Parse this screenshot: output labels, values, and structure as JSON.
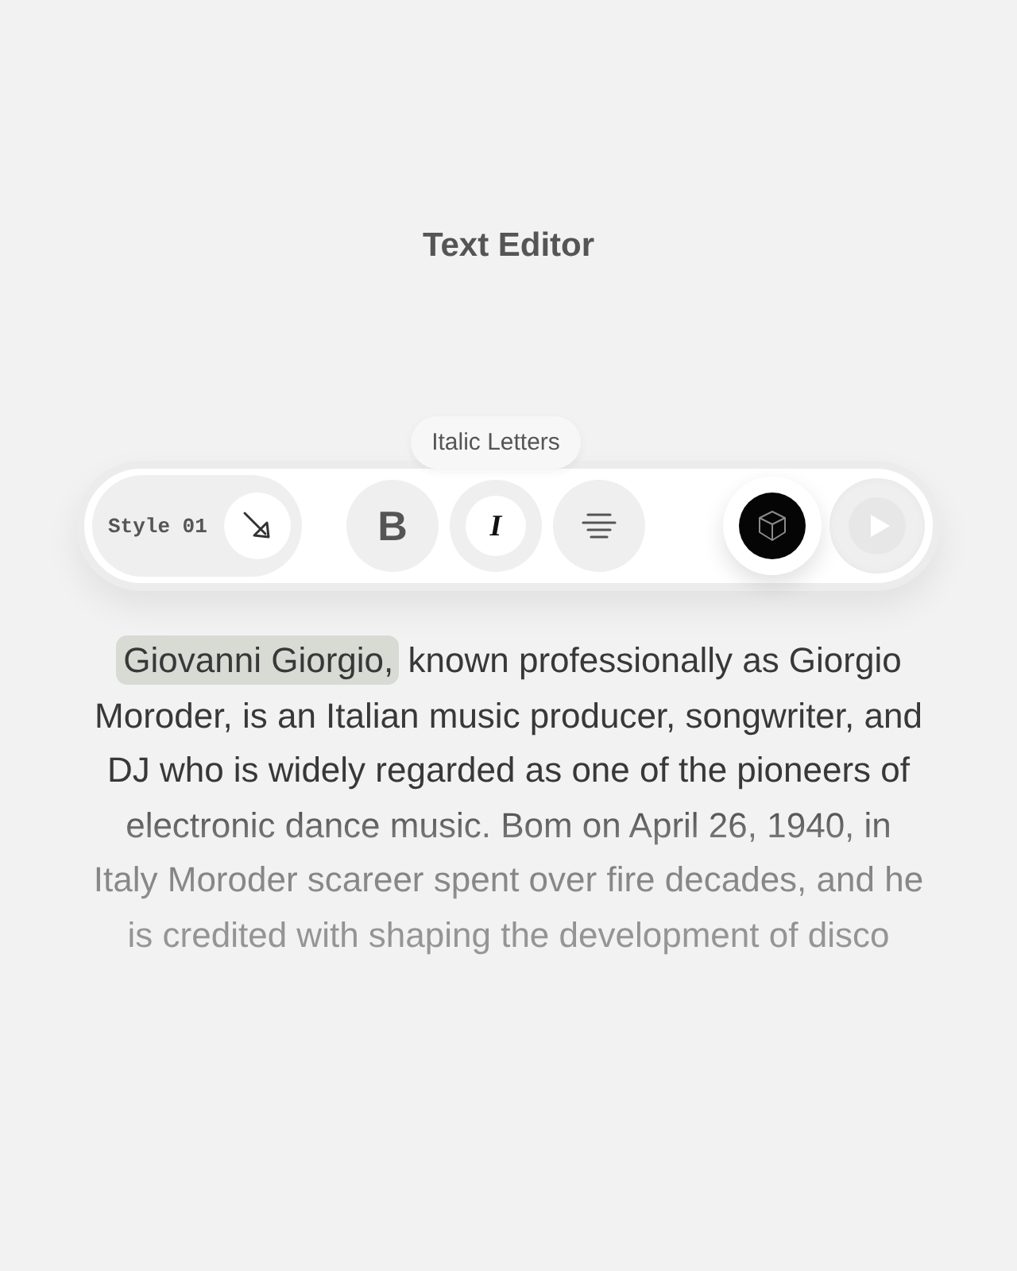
{
  "title": "Text Editor",
  "toolbar": {
    "style_picker": {
      "label": "Style 01"
    },
    "format_buttons": [
      {
        "kind": "bold",
        "label": "B",
        "selected": false
      },
      {
        "kind": "italic",
        "label": "I",
        "selected": true,
        "tooltip": "Italic Letters"
      },
      {
        "kind": "align",
        "selected": false
      }
    ]
  },
  "document": {
    "selected_text": "Giovanni Giorgio,",
    "text": "known professionally as Giorgio\nMoroder, is an Italian music producer, songwriter, and\nDJ who is widely regarded as one of the pioneers of\nelectronic dance music. Bom on April 26, 1940, in\nItaly Moroder scareer spent over fire decades, and he\nis credited with shaping the development of disco"
  }
}
